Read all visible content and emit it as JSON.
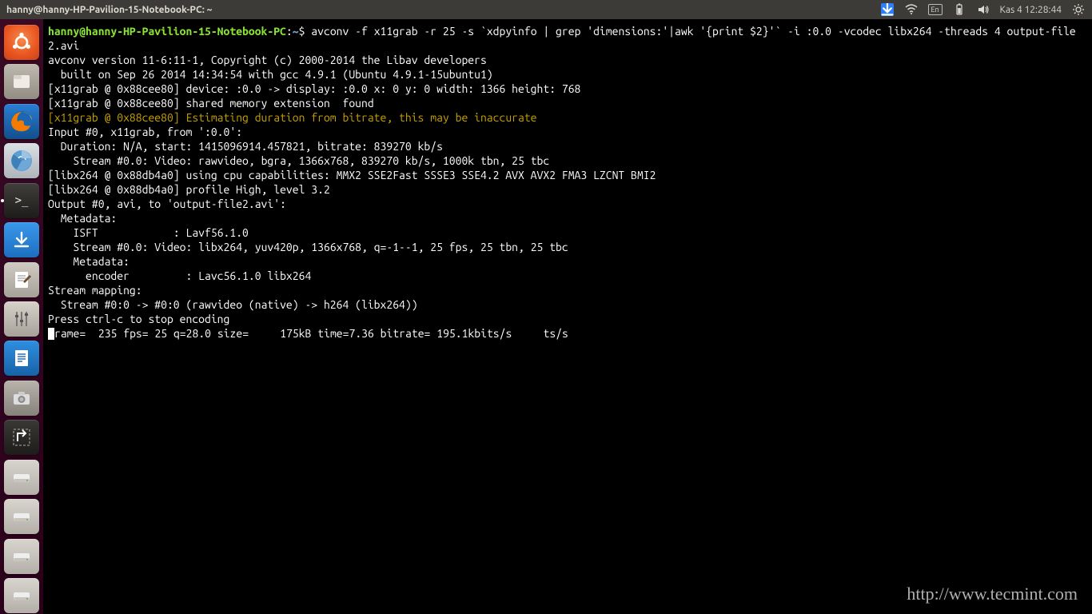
{
  "top_panel": {
    "title": "hanny@hanny-HP-Pavilion-15-Notebook-PC: ~",
    "lang": "En",
    "clock": "Kas 4 12:28:44"
  },
  "terminal": {
    "prompt_user": "hanny@hanny-HP-Pavilion-15-Notebook-PC",
    "prompt_sep": ":",
    "prompt_path": "~",
    "prompt_dollar": "$ ",
    "cmd": "avconv -f x11grab -r 25 -s `xdpyinfo | grep 'dimensions:'|awk '{print $2}'` -i :0.0 -vcodec libx264 -threads 4 output-file2.avi",
    "l1": "avconv version 11-6:11-1, Copyright (c) 2000-2014 the Libav developers",
    "l2": "  built on Sep 26 2014 14:34:54 with gcc 4.9.1 (Ubuntu 4.9.1-15ubuntu1)",
    "l3": "[x11grab @ 0x88cee80] device: :0.0 -> display: :0.0 x: 0 y: 0 width: 1366 height: 768",
    "l4": "[x11grab @ 0x88cee80] shared memory extension  found",
    "l5_warn": "[x11grab @ 0x88cee80] Estimating duration from bitrate, this may be inaccurate",
    "l6": "Input #0, x11grab, from ':0.0':",
    "l7": "  Duration: N/A, start: 1415096914.457821, bitrate: 839270 kb/s",
    "l8": "    Stream #0.0: Video: rawvideo, bgra, 1366x768, 839270 kb/s, 1000k tbn, 25 tbc",
    "l9": "[libx264 @ 0x88db4a0] using cpu capabilities: MMX2 SSE2Fast SSSE3 SSE4.2 AVX AVX2 FMA3 LZCNT BMI2",
    "l10": "[libx264 @ 0x88db4a0] profile High, level 3.2",
    "l11": "Output #0, avi, to 'output-file2.avi':",
    "l12": "  Metadata:",
    "l13": "    ISFT            : Lavf56.1.0",
    "l14": "    Stream #0.0: Video: libx264, yuv420p, 1366x768, q=-1--1, 25 fps, 25 tbn, 25 tbc",
    "l15": "    Metadata:",
    "l16": "      encoder         : Lavc56.1.0 libx264",
    "l17": "Stream mapping:",
    "l18": "  Stream #0:0 -> #0:0 (rawvideo (native) -> h264 (libx264))",
    "l19": "Press ctrl-c to stop encoding",
    "l20a": "rame=  235 fps= 25 q=28.0 size=     175kB time=7.36 bitrate= 195.1kbits/s     ts/s"
  },
  "watermark": "http://www.tecmint.com"
}
